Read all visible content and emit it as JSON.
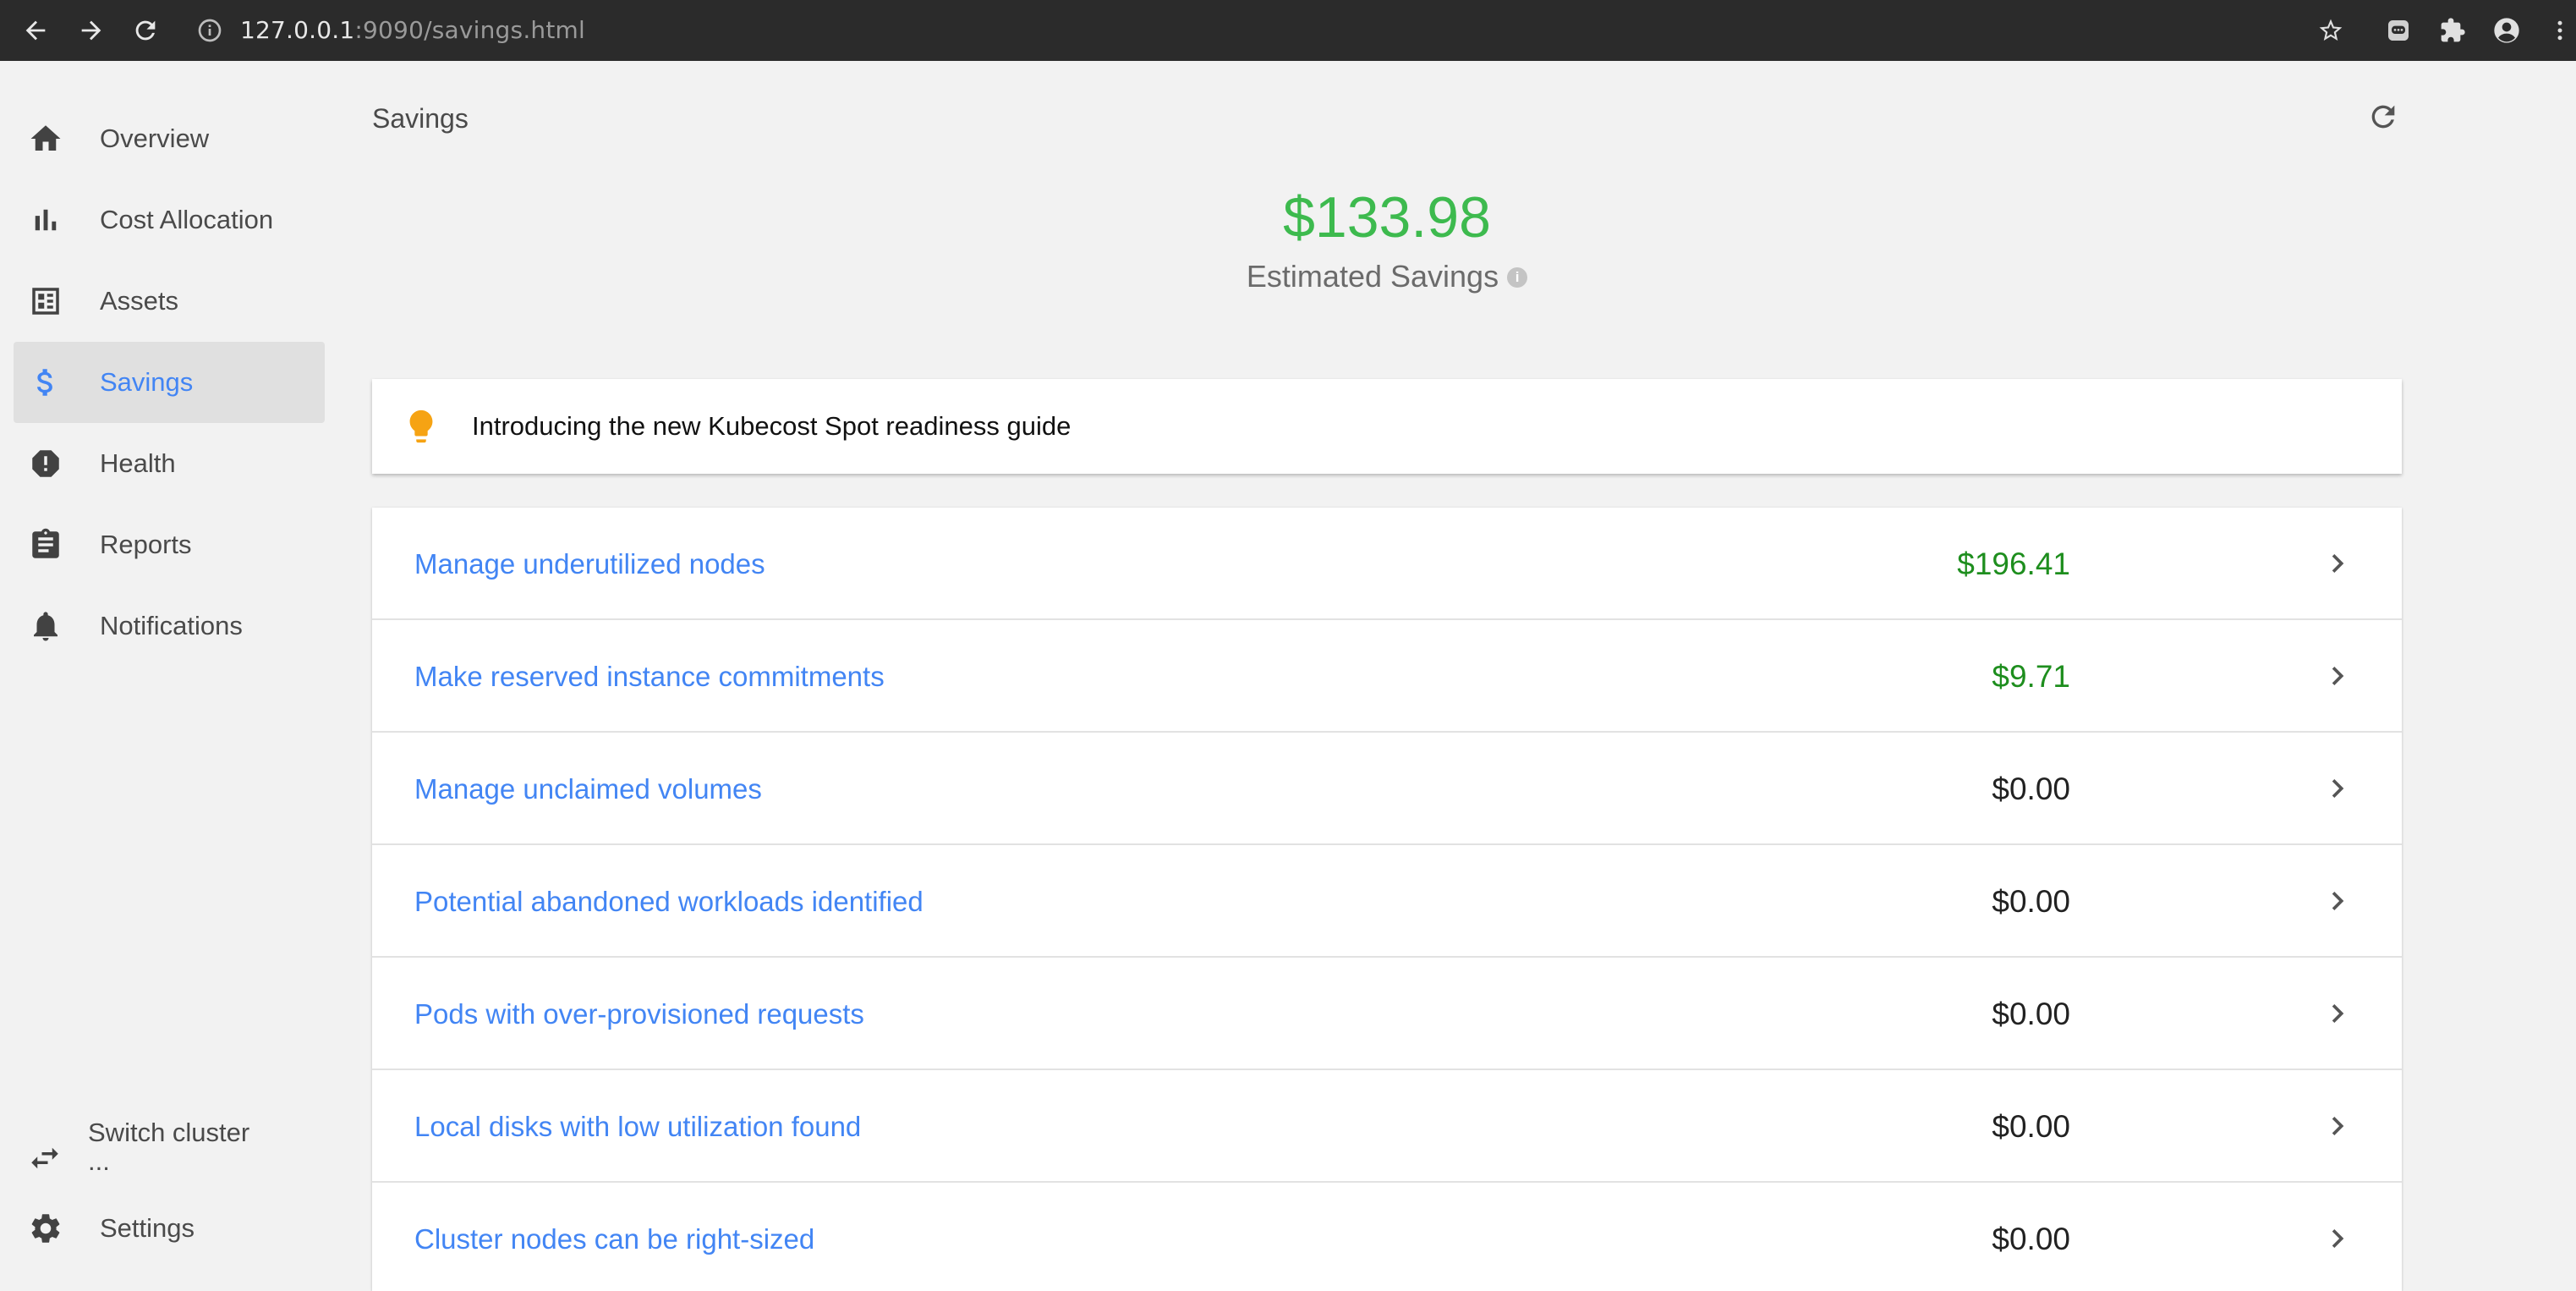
{
  "browser": {
    "url_host": "127.0.0.1",
    "url_path": ":9090/savings.html",
    "icons": [
      "back-icon",
      "forward-icon",
      "reload-icon",
      "info-icon",
      "star-icon",
      "extension-icon",
      "puzzle-icon",
      "profile-icon",
      "menu-icon"
    ]
  },
  "sidebar": {
    "items": [
      {
        "label": "Overview",
        "icon": "home-icon"
      },
      {
        "label": "Cost Allocation",
        "icon": "bar-chart-icon"
      },
      {
        "label": "Assets",
        "icon": "assets-icon"
      },
      {
        "label": "Savings",
        "icon": "dollar-icon",
        "active": true
      },
      {
        "label": "Health",
        "icon": "alert-icon"
      },
      {
        "label": "Reports",
        "icon": "clipboard-icon"
      },
      {
        "label": "Notifications",
        "icon": "bell-icon"
      }
    ],
    "switch_cluster": {
      "label": "Switch cluster",
      "sub": "...",
      "icon": "swap-icon"
    },
    "settings": {
      "label": "Settings",
      "icon": "gear-icon"
    }
  },
  "main": {
    "title": "Savings",
    "total_savings": "$133.98",
    "total_label": "Estimated Savings",
    "banner_text": "Introducing the new Kubecost Spot readiness guide",
    "recommendations": [
      {
        "label": "Manage underutilized nodes",
        "amount": "$196.41",
        "positive": true
      },
      {
        "label": "Make reserved instance commitments",
        "amount": "$9.71",
        "positive": true
      },
      {
        "label": "Manage unclaimed volumes",
        "amount": "$0.00",
        "positive": false
      },
      {
        "label": "Potential abandoned workloads identified",
        "amount": "$0.00",
        "positive": false
      },
      {
        "label": "Pods with over-provisioned requests",
        "amount": "$0.00",
        "positive": false
      },
      {
        "label": "Local disks with low utilization found",
        "amount": "$0.00",
        "positive": false
      },
      {
        "label": "Cluster nodes can be right-sized",
        "amount": "$0.00",
        "positive": false
      }
    ]
  },
  "colors": {
    "accent": "#4285f4",
    "savings_green": "#3dba4e",
    "amount_green": "#1e8e1e",
    "bulb": "#f6a313"
  }
}
